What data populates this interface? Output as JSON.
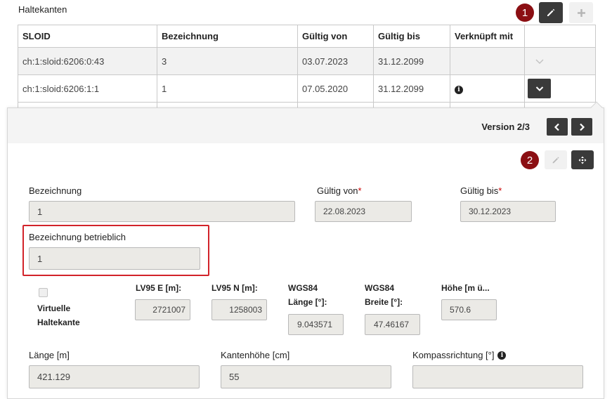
{
  "section": {
    "title": "Haltekanten"
  },
  "badges": {
    "one": "1",
    "two": "2"
  },
  "table": {
    "headers": [
      "SLOID",
      "Bezeichnung",
      "Gültig von",
      "Gültig bis",
      "Verknüpft mit",
      ""
    ],
    "rows": [
      {
        "sloid": "ch:1:sloid:6206:0:43",
        "bezeichnung": "3",
        "gueltig_von": "03.07.2023",
        "gueltig_bis": "31.12.2099",
        "verknuepft": ""
      },
      {
        "sloid": "ch:1:sloid:6206:1:1",
        "bezeichnung": "1",
        "gueltig_von": "07.05.2020",
        "gueltig_bis": "31.12.2099",
        "verknuepft": "i"
      }
    ]
  },
  "detail": {
    "version_label": "Version 2/3",
    "bezeichnung": {
      "label": "Bezeichnung",
      "value": "1"
    },
    "gueltig_von": {
      "label": "Gültig von",
      "required_mark": "*",
      "value": "22.08.2023"
    },
    "gueltig_bis": {
      "label": "Gültig bis",
      "required_mark": "*",
      "value": "30.12.2023"
    },
    "bezeichnung_betrieblich": {
      "label": "Bezeichnung betrieblich",
      "value": "1"
    },
    "virtuelle": {
      "label_line1": "Virtuelle",
      "label_line2": "Haltekante"
    },
    "lv95_e": {
      "label": "LV95 E [m]:",
      "value": "2721007"
    },
    "lv95_n": {
      "label": "LV95 N [m]:",
      "value": "1258003"
    },
    "wgs84_laenge": {
      "label_line1": "WGS84",
      "label_line2": "Länge [°]:",
      "value": "9.043571"
    },
    "wgs84_breite": {
      "label_line1": "WGS84",
      "label_line2": "Breite [°]:",
      "value": "47.46167"
    },
    "hoehe": {
      "label": "Höhe [m ü...",
      "value": "570.6"
    },
    "laenge": {
      "label": "Länge [m]",
      "value": "421.129"
    },
    "kantenhoehe": {
      "label": "Kantenhöhe [cm]",
      "value": "55"
    },
    "kompass": {
      "label": "Kompassrichtung [°]",
      "value": ""
    }
  },
  "icons": {
    "edit": "pencil-icon",
    "add": "plus-icon",
    "expand": "chevron-down-icon",
    "prev": "chevron-left-icon",
    "next": "chevron-right-icon",
    "info": "info-icon",
    "move": "move-icon"
  },
  "colors": {
    "badge": "#8b0f13",
    "highlight": "#d2232a",
    "dark_button": "#3a3a3a",
    "input_bg": "#ebeae6"
  }
}
